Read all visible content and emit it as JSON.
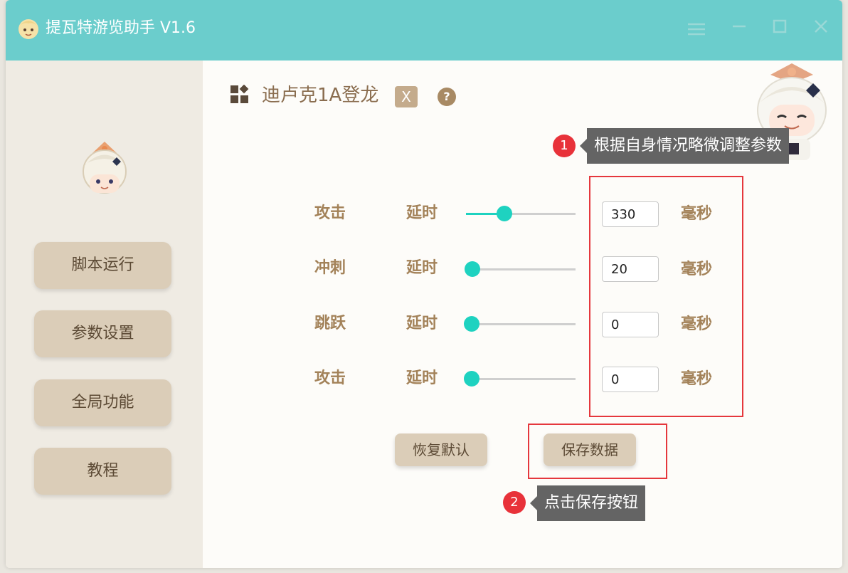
{
  "window": {
    "title": "提瓦特游览助手 V1.6"
  },
  "sidebar": {
    "items": [
      {
        "label": "脚本运行"
      },
      {
        "label": "参数设置"
      },
      {
        "label": "全局功能"
      },
      {
        "label": "教程"
      }
    ]
  },
  "page": {
    "title": "迪卢克1A登龙",
    "close_label": "X",
    "help_label": "?"
  },
  "callouts": [
    {
      "step": "1",
      "text": "根据自身情况略微调整参数"
    },
    {
      "step": "2",
      "text": "点击保存按钮"
    }
  ],
  "params": [
    {
      "action": "攻击",
      "type": "延时",
      "value": "330",
      "unit": "毫秒",
      "level": 0.35
    },
    {
      "action": "冲刺",
      "type": "延时",
      "value": "20",
      "unit": "毫秒",
      "level": 0.06
    },
    {
      "action": "跳跃",
      "type": "延时",
      "value": "0",
      "unit": "毫秒",
      "level": 0.05
    },
    {
      "action": "攻击",
      "type": "延时",
      "value": "0",
      "unit": "毫秒",
      "level": 0.05
    }
  ],
  "buttons": {
    "reset_label": "恢复默认",
    "save_label": "保存数据"
  },
  "colors": {
    "titlebar": "#6bcdcc",
    "accent": "#1ed2c0",
    "button": "#dbcdb8",
    "label": "#a38259",
    "highlight": "#e5373d"
  }
}
